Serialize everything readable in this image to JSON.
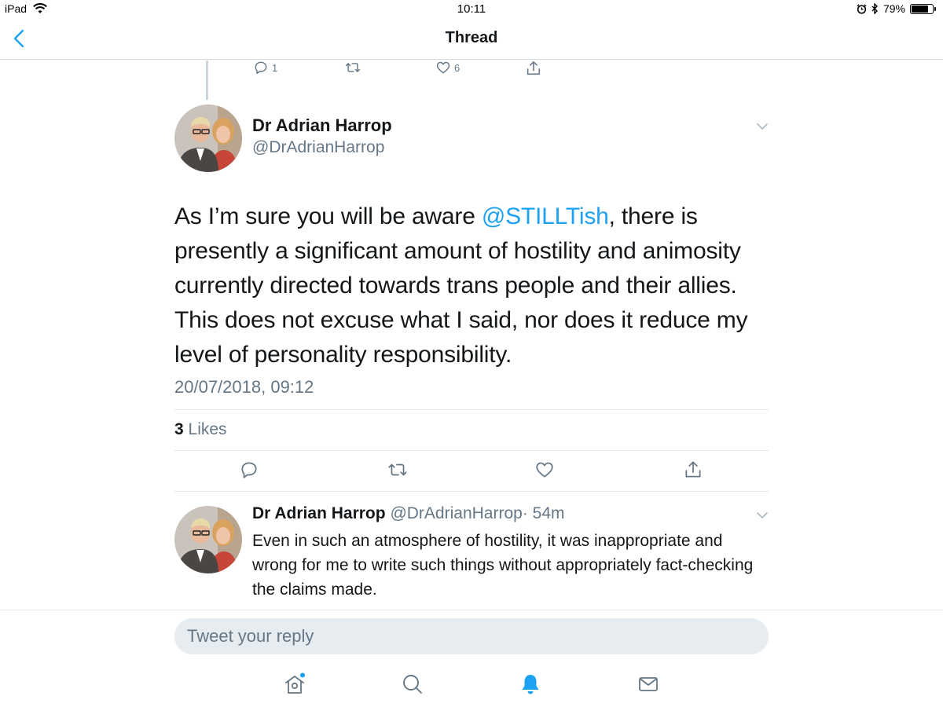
{
  "status_bar": {
    "device": "iPad",
    "time": "10:11",
    "battery": "79%",
    "battery_level": 0.79
  },
  "nav": {
    "title": "Thread",
    "back_icon": "chevron-left-icon"
  },
  "previous_tweet": {
    "reply_count": "1",
    "retweet_count": "",
    "like_count": "6"
  },
  "main_tweet": {
    "author_name": "Dr Adrian Harrop",
    "author_handle": "@DrAdrianHarrop",
    "text_before": "As I’m sure you will be aware ",
    "mention": "@STILLTish",
    "text_after": ", there is presently a significant amount of hostility and animosity currently directed towards trans people and their allies. This does not excuse what I said, nor does it reduce my level of personality responsibility.",
    "timestamp": "20/07/2018, 09:12",
    "likes_count": "3",
    "likes_label": "Likes"
  },
  "reply_tweet": {
    "author_name": "Dr Adrian Harrop",
    "author_handle": "@DrAdrianHarrop",
    "time": "· 54m",
    "text": "Even in such an atmosphere of hostility, it was inappropriate and wrong for me to write such things without appropriately fact-checking the claims made."
  },
  "composer": {
    "placeholder": "Tweet your reply"
  },
  "tab_bar": {
    "items": [
      "home-icon",
      "search-icon",
      "notifications-icon",
      "messages-icon"
    ],
    "active": "notifications-icon"
  },
  "colors": {
    "accent": "#1da1f2",
    "secondary_text": "#657786",
    "divider": "#e1e8ed"
  }
}
